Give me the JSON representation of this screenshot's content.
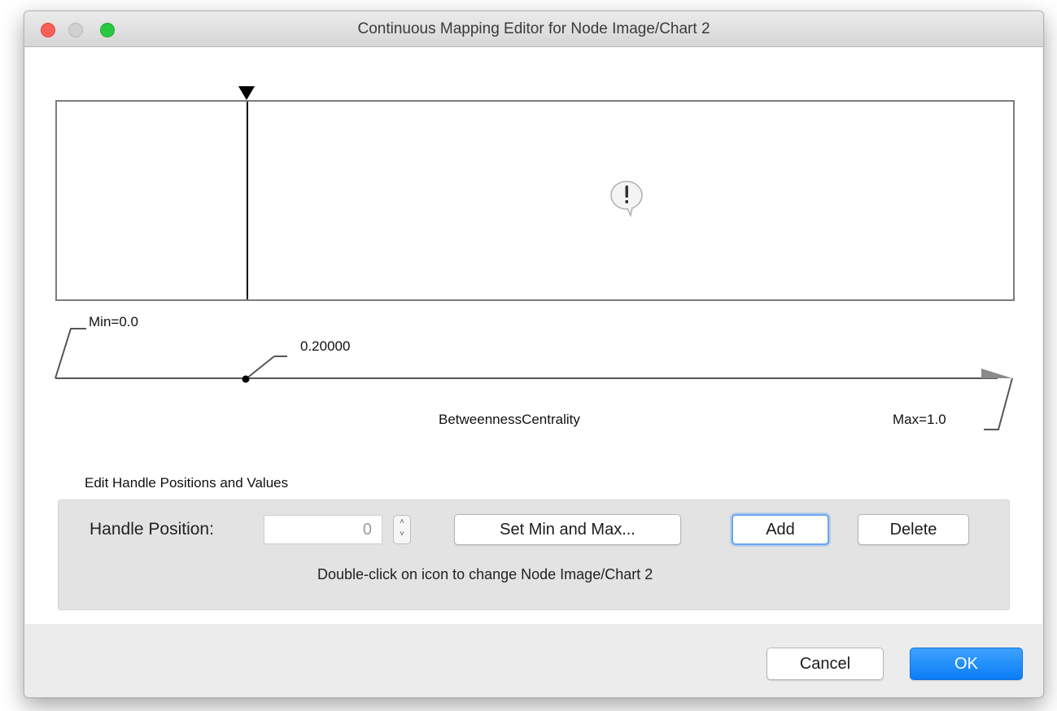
{
  "window": {
    "title": "Continuous Mapping Editor for Node Image/Chart 2"
  },
  "mapping": {
    "min_label": "Min=0.0",
    "max_label": "Max=1.0",
    "handle_value_label": "0.20000",
    "attribute_label": "BetweennessCentrality",
    "handle_position_fraction": 0.2,
    "alert_icon": "exclamation-speech-bubble-icon"
  },
  "edit": {
    "section_label": "Edit Handle Positions and Values",
    "handle_position_label": "Handle Position:",
    "handle_position_value": "0",
    "set_min_max_label": "Set Min and Max...",
    "add_label": "Add",
    "delete_label": "Delete",
    "hint": "Double-click on icon to change Node Image/Chart 2"
  },
  "footer": {
    "cancel_label": "Cancel",
    "ok_label": "OK"
  },
  "colors": {
    "ok_button": "#0a7cf6",
    "close_button": "#fc5f57",
    "maximize_button": "#28c83f",
    "panel_background": "#e3e3e3"
  }
}
